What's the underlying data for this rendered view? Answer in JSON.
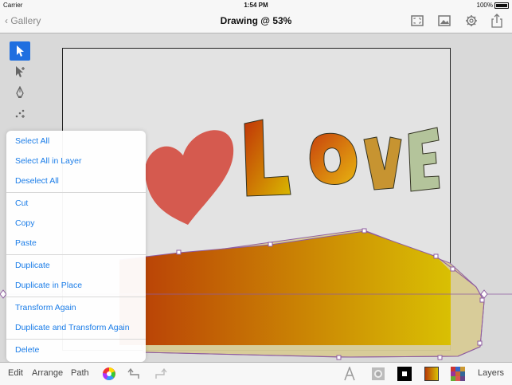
{
  "status": {
    "carrier": "Carrier",
    "time": "1:54 PM",
    "battery": "100%"
  },
  "nav": {
    "back_label": "Gallery",
    "title": "Drawing @ 53%"
  },
  "artwork": {
    "word": "LOVE"
  },
  "menu": {
    "groups": [
      [
        "Select All",
        "Select All in Layer",
        "Deselect All"
      ],
      [
        "Cut",
        "Copy",
        "Paste"
      ],
      [
        "Duplicate",
        "Duplicate in Place"
      ],
      [
        "Transform Again",
        "Duplicate and Transform Again"
      ],
      [
        "Delete"
      ]
    ]
  },
  "bottom": {
    "edit": "Edit",
    "arrange": "Arrange",
    "path": "Path",
    "layers": "Layers"
  },
  "colors": {
    "accent": "#1f6fe0",
    "menu_text": "#1b7de8",
    "heart": "#d55a4f",
    "gradient_start": "#b83a06",
    "gradient_end": "#d9c003"
  }
}
